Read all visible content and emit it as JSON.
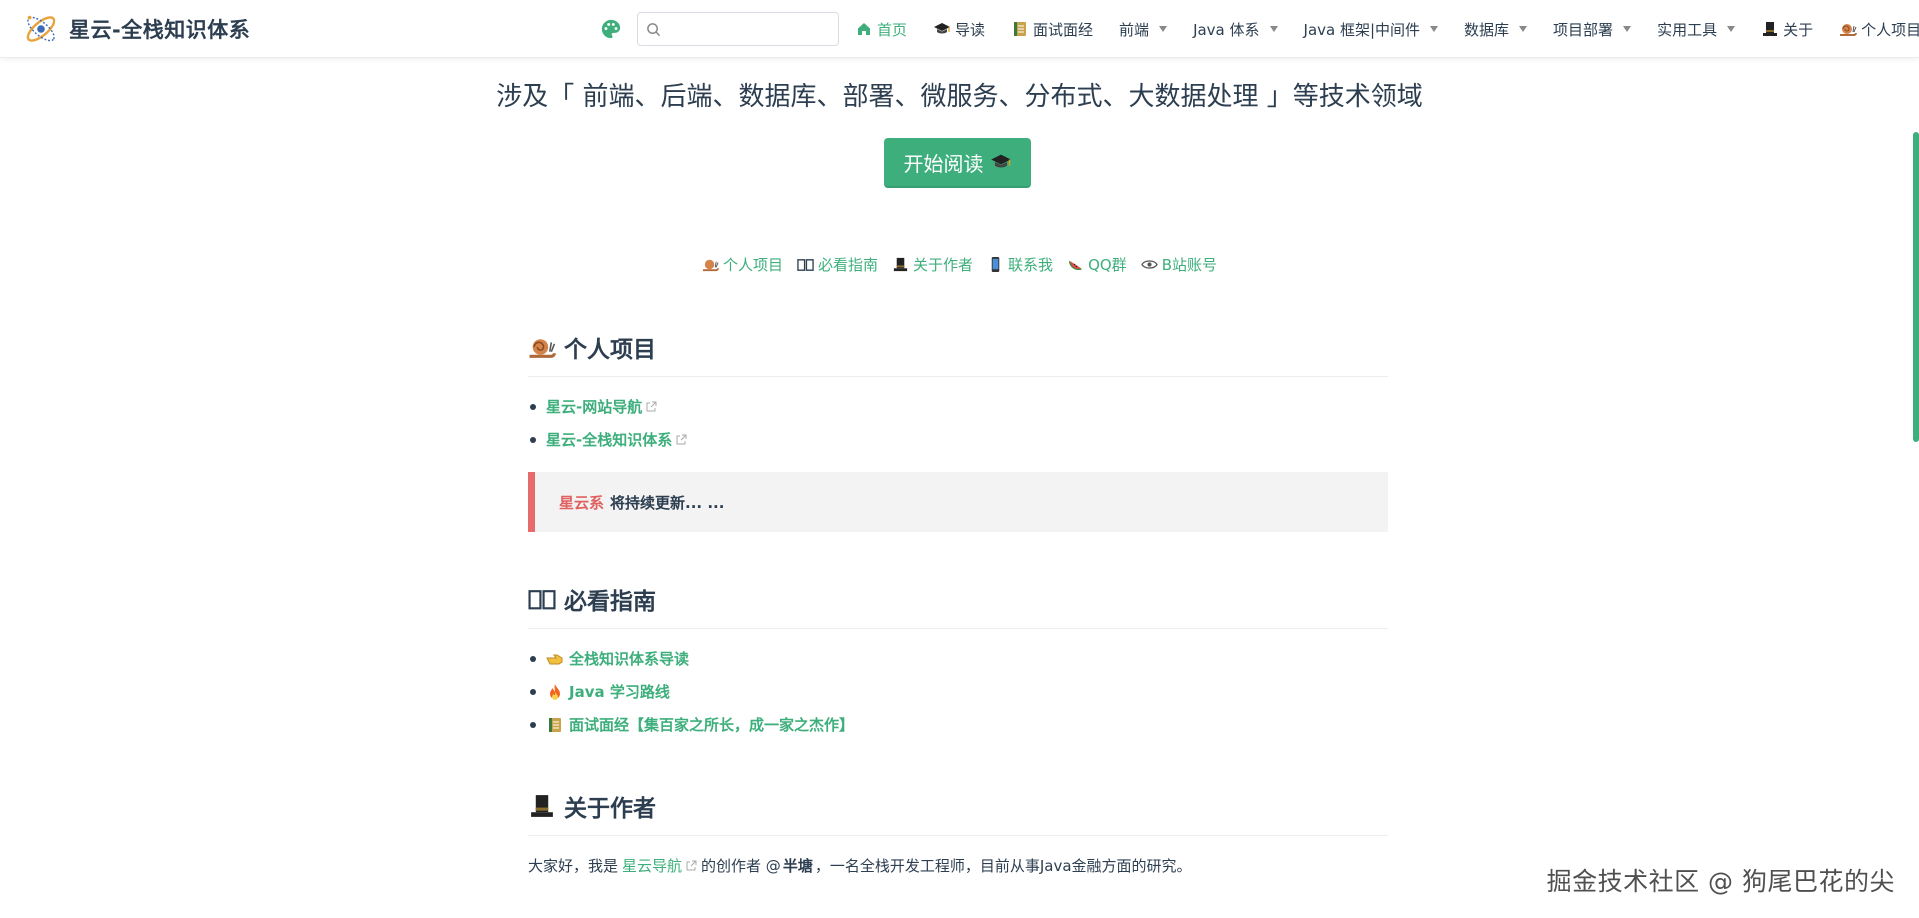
{
  "brand": {
    "title": "星云-全栈知识体系",
    "logo_icon": "orbit-logo-icon"
  },
  "search": {
    "placeholder": "",
    "value": ""
  },
  "nav": [
    {
      "label": "首页",
      "icon": "home-icon",
      "active": true,
      "dropdown": false
    },
    {
      "label": "导读",
      "icon": "graduation-cap-icon",
      "active": false,
      "dropdown": false
    },
    {
      "label": "面试面经",
      "icon": "ledger-icon",
      "active": false,
      "dropdown": false
    },
    {
      "label": "前端",
      "icon": "",
      "active": false,
      "dropdown": true
    },
    {
      "label": "Java 体系",
      "icon": "",
      "active": false,
      "dropdown": true
    },
    {
      "label": "Java 框架|中间件",
      "icon": "",
      "active": false,
      "dropdown": true
    },
    {
      "label": "数据库",
      "icon": "",
      "active": false,
      "dropdown": true
    },
    {
      "label": "项目部署",
      "icon": "",
      "active": false,
      "dropdown": true
    },
    {
      "label": "实用工具",
      "icon": "",
      "active": false,
      "dropdown": true
    },
    {
      "label": "关于",
      "icon": "top-hat-icon",
      "active": false,
      "dropdown": false
    },
    {
      "label": "个人项目",
      "icon": "snail-icon",
      "active": false,
      "dropdown": true
    }
  ],
  "hero": {
    "tagline": "涉及「 前端、后端、数据库、部署、微服务、分布式、大数据处理 」等技术领域",
    "cta_label": "开始阅读"
  },
  "quick_links": [
    {
      "label": "个人项目",
      "icon": "snail-icon"
    },
    {
      "label": "必看指南",
      "icon": "open-book-icon"
    },
    {
      "label": "关于作者",
      "icon": "top-hat-icon"
    },
    {
      "label": "联系我",
      "icon": "mobile-phone-icon"
    },
    {
      "label": "QQ群",
      "icon": "watermelon-icon"
    },
    {
      "label": "B站账号",
      "icon": "eye-icon"
    }
  ],
  "sections": {
    "projects": {
      "title": "个人项目",
      "items": [
        "星云-网站导航",
        "星云-全栈知识体系"
      ],
      "callout_accent": "星云系",
      "callout_text": "将持续更新... ..."
    },
    "guide": {
      "title": "必看指南",
      "items": [
        "全栈知识体系导读",
        "Java 学习路线",
        "面试面经【集百家之所长，成一家之杰作】"
      ]
    },
    "about": {
      "title": "关于作者",
      "text_before": "大家好，我是",
      "link": "星云导航",
      "text_mid": "的创作者 @",
      "name": "半塘",
      "text_after": "，一名全栈开发工程师，目前从事Java金融方面的研究。"
    }
  },
  "watermark": "掘金技术社区 @ 狗尾巴花的尖",
  "colors": {
    "accent": "#3eaf7c",
    "callout_border": "#e76b6b",
    "text": "#2c3e50"
  }
}
